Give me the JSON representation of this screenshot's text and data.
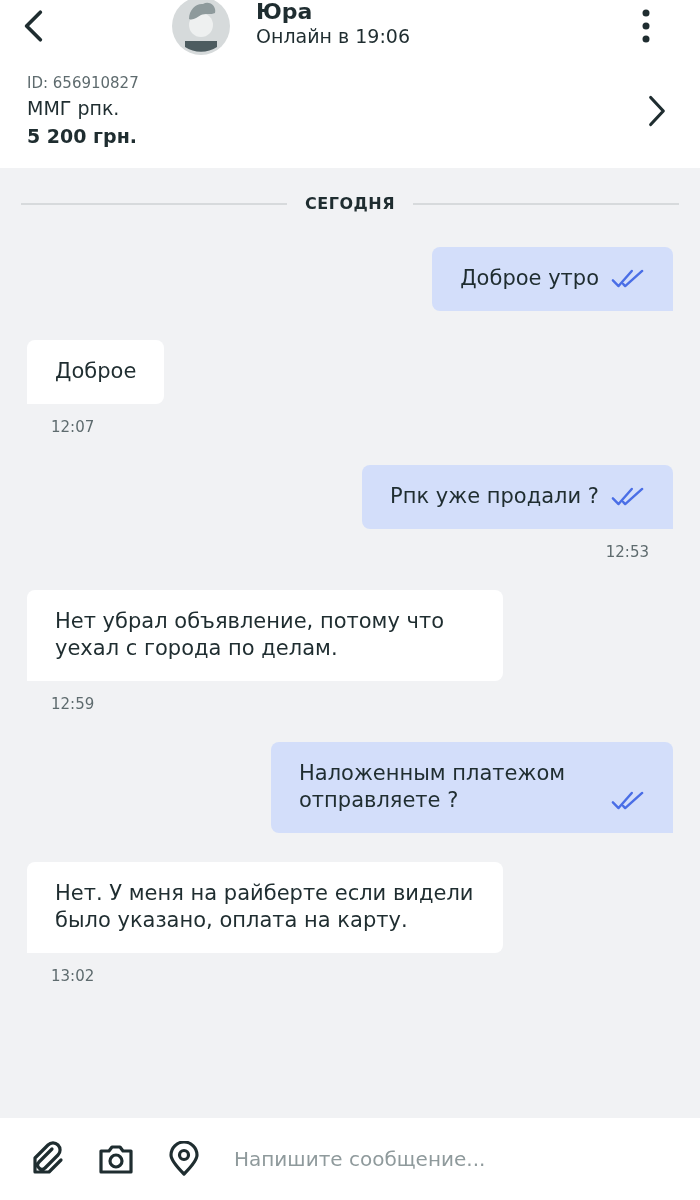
{
  "header": {
    "contact_name": "Юра",
    "status": "Онлайн в 19:06"
  },
  "listing": {
    "id": "ID: 656910827",
    "title": "ММГ рпк.",
    "price": "5 200 грн."
  },
  "date_divider": "СЕГОДНЯ",
  "messages": [
    {
      "kind": "outgoing",
      "text": "Доброе утро",
      "read": true
    },
    {
      "kind": "incoming",
      "text": "Доброе",
      "time": "12:07"
    },
    {
      "kind": "outgoing",
      "text": "Рпк уже продали ?",
      "read": true,
      "time": "12:53"
    },
    {
      "kind": "incoming",
      "text": "Нет убрал объявление, потому что уехал с города по делам.",
      "time": "12:59"
    },
    {
      "kind": "outgoing",
      "text": "Наложенным платежом отправляете ?",
      "read": true
    },
    {
      "kind": "incoming",
      "text": "Нет. У меня на райберте если видели было указано, оплата на карту.",
      "time": "13:02"
    }
  ],
  "composer": {
    "placeholder": "Напишите сообщение..."
  }
}
